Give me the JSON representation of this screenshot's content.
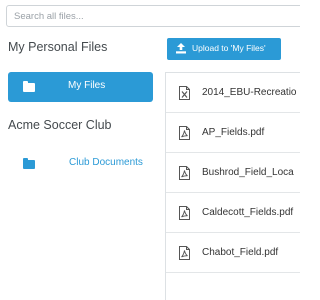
{
  "search": {
    "placeholder": "Search all files..."
  },
  "sidebar": {
    "personal_title": "My Personal Files",
    "my_files_label": "My Files",
    "club_title": "Acme Soccer Club",
    "club_documents_label": "Club Documents"
  },
  "toolbar": {
    "upload_label": "Upload to 'My Files'"
  },
  "files": [
    {
      "name": "2014_EBU-Recreatio",
      "type": "spreadsheet"
    },
    {
      "name": "AP_Fields.pdf",
      "type": "pdf"
    },
    {
      "name": "Bushrod_Field_Loca",
      "type": "pdf"
    },
    {
      "name": "Caldecott_Fields.pdf",
      "type": "pdf"
    },
    {
      "name": "Chabot_Field.pdf",
      "type": "pdf"
    }
  ],
  "colors": {
    "accent": "#2b9ad6",
    "text": "#444a4e",
    "border": "#dde1e4"
  }
}
